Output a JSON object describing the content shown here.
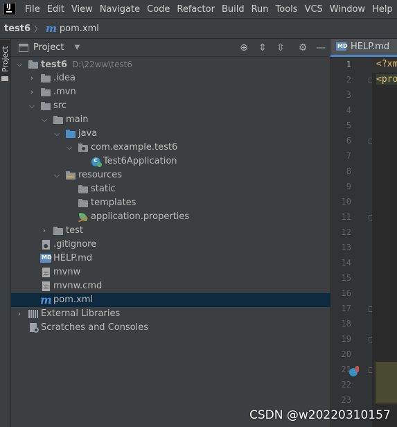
{
  "menubar": {
    "logo_text": "IJ",
    "items": [
      "File",
      "Edit",
      "View",
      "Navigate",
      "Code",
      "Refactor",
      "Build",
      "Run",
      "Tools",
      "VCS",
      "Window",
      "Help"
    ]
  },
  "breadcrumb": {
    "project": "test6",
    "file": "pom.xml"
  },
  "toolstrip": {
    "label": "Project"
  },
  "panel": {
    "title": "Project",
    "tree": [
      {
        "label": "test6",
        "hint": "D:\\22ww\\test6",
        "icon": "module-folder-icon",
        "expanded": true
      },
      {
        "label": ".idea",
        "icon": "folder-icon",
        "expanded": false
      },
      {
        "label": ".mvn",
        "icon": "folder-icon",
        "expanded": false
      },
      {
        "label": "src",
        "icon": "folder-icon",
        "expanded": true
      },
      {
        "label": "main",
        "icon": "folder-icon",
        "expanded": true
      },
      {
        "label": "java",
        "icon": "source-folder-icon",
        "expanded": true
      },
      {
        "label": "com.example.test6",
        "icon": "package-icon",
        "expanded": true
      },
      {
        "label": "Test6Application",
        "icon": "spring-class-icon"
      },
      {
        "label": "resources",
        "icon": "resources-folder-icon",
        "expanded": true
      },
      {
        "label": "static",
        "icon": "folder-icon"
      },
      {
        "label": "templates",
        "icon": "folder-icon"
      },
      {
        "label": "application.properties",
        "icon": "spring-properties-icon"
      },
      {
        "label": "test",
        "icon": "folder-icon",
        "expanded": false
      },
      {
        "label": ".gitignore",
        "icon": "gitignore-file-icon"
      },
      {
        "label": "HELP.md",
        "icon": "markdown-file-icon"
      },
      {
        "label": "mvnw",
        "icon": "text-file-icon"
      },
      {
        "label": "mvnw.cmd",
        "icon": "text-file-icon"
      },
      {
        "label": "pom.xml",
        "icon": "maven-icon",
        "selected": true
      },
      {
        "label": "External Libraries",
        "icon": "libraries-icon",
        "expanded": false
      },
      {
        "label": "Scratches and Consoles",
        "icon": "scratches-icon"
      }
    ]
  },
  "editor": {
    "tab_label": "HELP.md",
    "line_numbers": [
      "1",
      "2",
      "3",
      "4",
      "5",
      "6",
      "7",
      "8",
      "9",
      "10",
      "11",
      "12",
      "13",
      "14",
      "15",
      "16",
      "17",
      "18",
      "19",
      "20",
      "21",
      "22",
      "23"
    ],
    "code_line_1": "<?xm",
    "code_line_2": "<pro"
  },
  "watermark": "CSDN @w20220310157"
}
